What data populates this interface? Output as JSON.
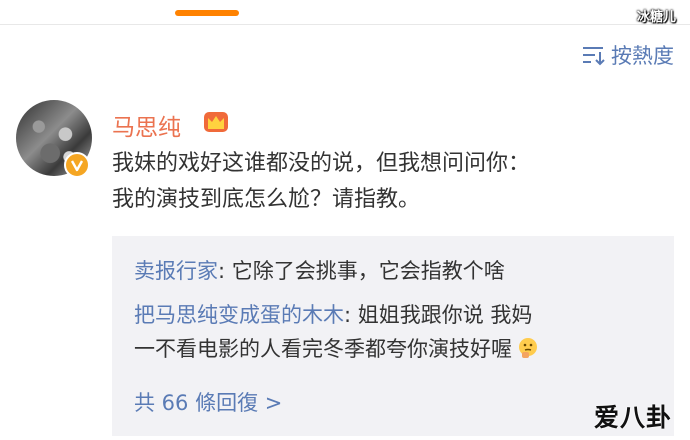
{
  "header": {
    "watermark": "冰糖儿",
    "sort_label": "按熱度",
    "sort_icon": "sort-icon"
  },
  "comment": {
    "username": "马思纯",
    "badge_icon": "crown-icon",
    "verified_icon": "verified-icon",
    "text_lines": [
      "我妹的戏好这谁都没的说，但我想问问你：",
      "我的演技到底怎么尬？请指教。"
    ]
  },
  "replies": [
    {
      "user": "卖报行家",
      "text_lines": [
        ": 它除了会挑事，它会指教个啥"
      ]
    },
    {
      "user": "把马思纯变成蛋的木木",
      "text_lines": [
        ": 姐姐我跟你说 我妈",
        "一不看电影的人看完冬季都夸你演技好喔"
      ],
      "emoji": "thinking-face-icon"
    }
  ],
  "more_replies": "共 66 條回復 >",
  "footer_watermark": "爱八卦",
  "colors": {
    "accent": "#ff8200",
    "username": "#eb7350",
    "link": "#5a7bb5",
    "reply_bg": "#f2f2f5"
  }
}
